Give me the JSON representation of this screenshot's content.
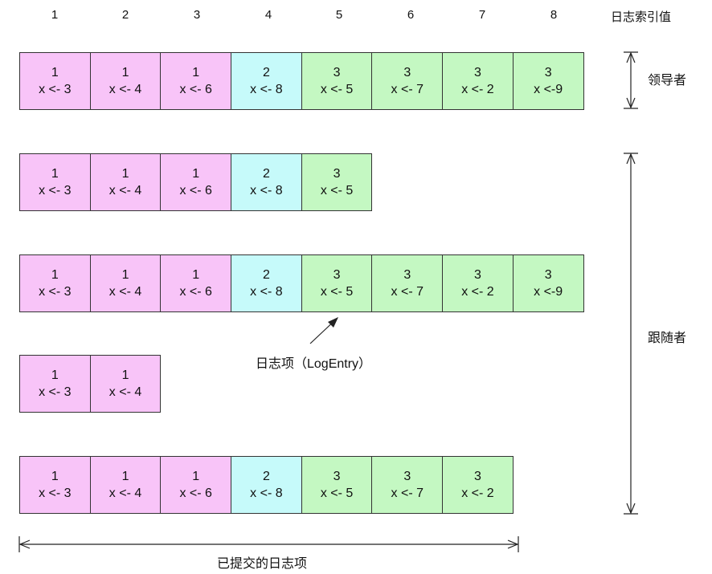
{
  "index_header": {
    "indices": [
      "1",
      "2",
      "3",
      "4",
      "5",
      "6",
      "7",
      "8"
    ],
    "title": "日志索引值"
  },
  "rows": [
    {
      "name": "leader",
      "entries": [
        {
          "term": "1",
          "cmd": "x <- 3"
        },
        {
          "term": "1",
          "cmd": "x <- 4"
        },
        {
          "term": "1",
          "cmd": "x <- 6"
        },
        {
          "term": "2",
          "cmd": "x <- 8"
        },
        {
          "term": "3",
          "cmd": "x <- 5"
        },
        {
          "term": "3",
          "cmd": "x <- 7"
        },
        {
          "term": "3",
          "cmd": "x <- 2"
        },
        {
          "term": "3",
          "cmd": "x <-9"
        }
      ]
    },
    {
      "name": "follower-1",
      "entries": [
        {
          "term": "1",
          "cmd": "x <- 3"
        },
        {
          "term": "1",
          "cmd": "x <- 4"
        },
        {
          "term": "1",
          "cmd": "x <- 6"
        },
        {
          "term": "2",
          "cmd": "x <- 8"
        },
        {
          "term": "3",
          "cmd": "x <- 5"
        }
      ]
    },
    {
      "name": "follower-2",
      "entries": [
        {
          "term": "1",
          "cmd": "x <- 3"
        },
        {
          "term": "1",
          "cmd": "x <- 4"
        },
        {
          "term": "1",
          "cmd": "x <- 6"
        },
        {
          "term": "2",
          "cmd": "x <- 8"
        },
        {
          "term": "3",
          "cmd": "x <- 5"
        },
        {
          "term": "3",
          "cmd": "x <- 7"
        },
        {
          "term": "3",
          "cmd": "x <- 2"
        },
        {
          "term": "3",
          "cmd": "x <-9"
        }
      ]
    },
    {
      "name": "follower-3",
      "entries": [
        {
          "term": "1",
          "cmd": "x <- 3"
        },
        {
          "term": "1",
          "cmd": "x <- 4"
        }
      ]
    },
    {
      "name": "follower-4",
      "entries": [
        {
          "term": "1",
          "cmd": "x <- 3"
        },
        {
          "term": "1",
          "cmd": "x <- 4"
        },
        {
          "term": "1",
          "cmd": "x <- 6"
        },
        {
          "term": "2",
          "cmd": "x <- 8"
        },
        {
          "term": "3",
          "cmd": "x <- 5"
        },
        {
          "term": "3",
          "cmd": "x <- 7"
        },
        {
          "term": "3",
          "cmd": "x <- 2"
        }
      ]
    }
  ],
  "term_colors": {
    "1": "#f8c4f8",
    "2": "#c6fafa",
    "3": "#c4f8c2"
  },
  "labels": {
    "leader": "领导者",
    "follower": "跟随者",
    "log_entry": "日志项（LogEntry）",
    "committed": "已提交的日志项"
  }
}
